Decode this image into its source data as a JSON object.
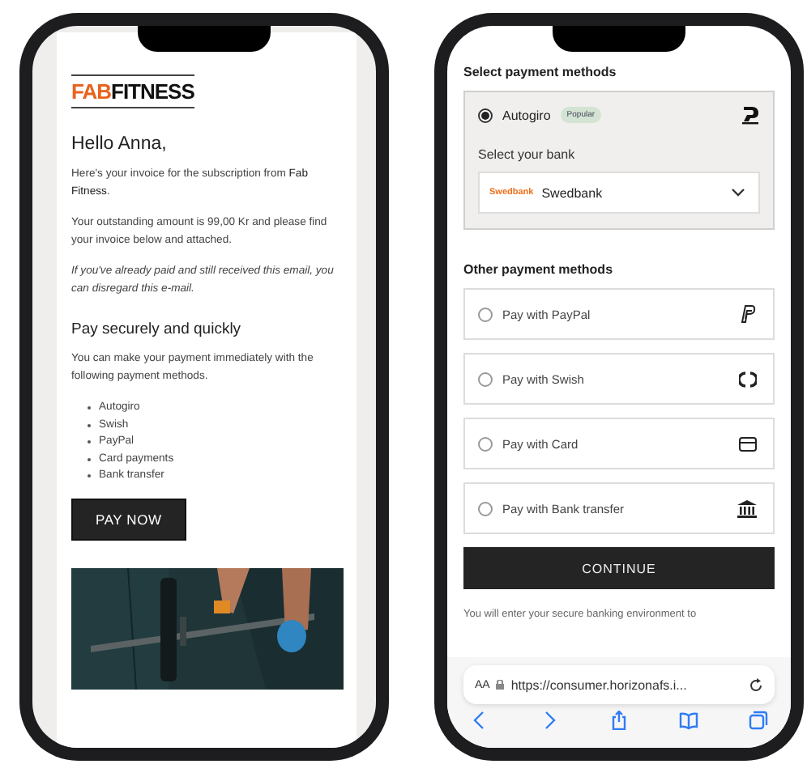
{
  "email": {
    "logo": {
      "part_1": "FAB",
      "part_2": "FITNESS"
    },
    "greeting": "Hello Anna,",
    "paragraphs": [
      {
        "kind": "normal",
        "text": "Here's your invoice for the subscription from **Fab Fitness**."
      },
      {
        "kind": "normal",
        "text": "Your outstanding amount is 99,00 Kr and please find your invoice below and attached."
      },
      {
        "kind": "italic",
        "text": "If you've already paid and still received this email, you can disregard this e-mail."
      }
    ],
    "heading": "Pay securely and quickly",
    "intro": "You can make your payment immediately with the following payment methods.",
    "methods": [
      "Autogiro",
      "Swish",
      "PayPal",
      "Card payments",
      "Bank transfer"
    ],
    "button": "PAY NOW"
  },
  "checkout": {
    "title": "Select payment methods",
    "primary": {
      "label": "Autogiro",
      "badge": "Popular",
      "selected": true,
      "bank_label": "Select your bank",
      "bank_logo": "Swedbank",
      "bank": "Swedbank"
    },
    "other_title": "Other payment methods",
    "options": [
      {
        "kind": "paypal",
        "label": "Pay with PayPal",
        "selected": false
      },
      {
        "kind": "swish",
        "label": "Pay with Swish",
        "selected": false
      },
      {
        "kind": "card",
        "label": "Pay with Card",
        "selected": false
      },
      {
        "kind": "bank",
        "label": "Pay with Bank transfer",
        "selected": false
      }
    ],
    "continue": "CONTINUE",
    "note": "You will enter your secure banking environment to"
  },
  "browser": {
    "text_size": "AA",
    "url": "https://consumer.horizonafs.i..."
  }
}
